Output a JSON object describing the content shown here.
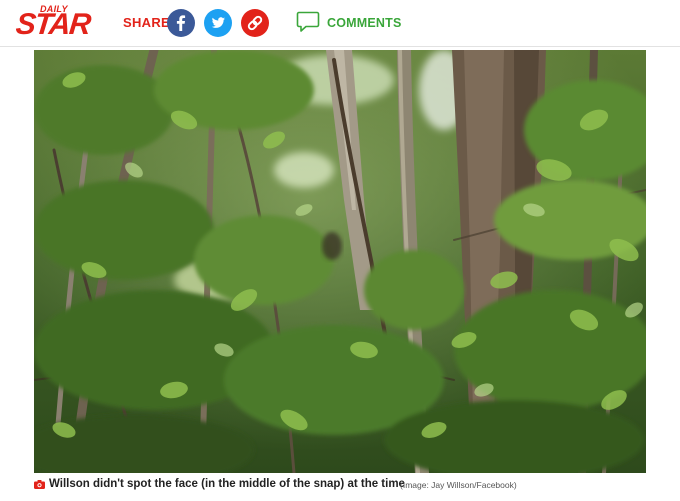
{
  "header": {
    "logo_small": "DAILY",
    "logo_main": "STAR",
    "share_label": "SHARE",
    "share_buttons": [
      {
        "icon": "facebook-icon",
        "color": "#3b5998"
      },
      {
        "icon": "twitter-icon",
        "color": "#1da1f2"
      },
      {
        "icon": "link-icon",
        "color": "#e2231a"
      }
    ],
    "comments_label": "COMMENTS"
  },
  "colors": {
    "brand_red": "#e2231a",
    "comments_green": "#3aa63a"
  },
  "photo": {
    "icon": "camera-icon"
  },
  "caption": {
    "text": "Willson didn't spot the face (in the middle of the snap) at the time",
    "credit": "(Image: Jay Willson/Facebook)"
  }
}
